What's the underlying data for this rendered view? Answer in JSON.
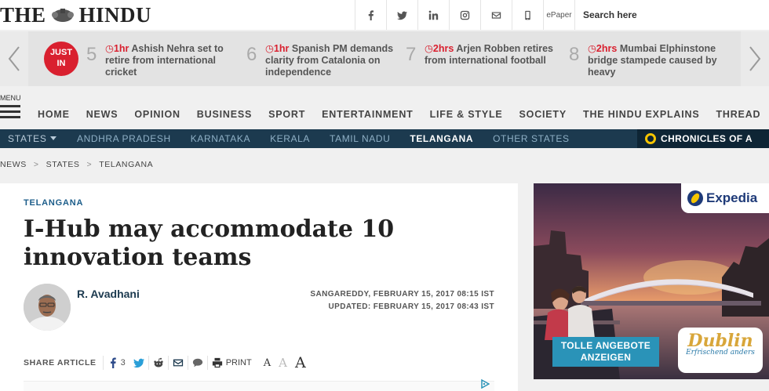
{
  "header": {
    "logo": "THE HINDU",
    "logo_left": "THE",
    "logo_right": "HINDU",
    "social_icons": [
      "facebook-icon",
      "twitter-icon",
      "linkedin-icon",
      "instagram-icon",
      "email-icon",
      "mobile-icon"
    ],
    "epaper_label": "ePaper",
    "search_label": "Search here"
  },
  "ticker": {
    "badge_line1": "JUST",
    "badge_line2": "IN",
    "items": [
      {
        "num": "5",
        "time": "1hr",
        "text": "Ashish Nehra set to retire from international cricket"
      },
      {
        "num": "6",
        "time": "1hr",
        "text": "Spanish PM demands clarity from Catalonia on independence"
      },
      {
        "num": "7",
        "time": "2hrs",
        "text": "Arjen Robben retires from international football"
      },
      {
        "num": "8",
        "time": "2hrs",
        "text": "Mumbai Elphinstone bridge stampede caused by heavy"
      }
    ]
  },
  "nav": {
    "menu_label": "MENU",
    "items": [
      "HOME",
      "NEWS",
      "OPINION",
      "BUSINESS",
      "SPORT",
      "ENTERTAINMENT",
      "LIFE & STYLE",
      "SOCIETY",
      "THE HINDU EXPLAINS",
      "THREAD"
    ]
  },
  "subnav": {
    "states_label": "STATES",
    "items": [
      "ANDHRA PRADESH",
      "KARNATAKA",
      "KERALA",
      "TAMIL NADU",
      "TELANGANA",
      "OTHER STATES"
    ],
    "active": "TELANGANA",
    "chronicles_label": "CHRONICLES OF A"
  },
  "breadcrumb": [
    "NEWS",
    "STATES",
    "TELANGANA"
  ],
  "article": {
    "section": "TELANGANA",
    "headline": "I-Hub may accommodate 10 innovation teams",
    "author": "R. Avadhani",
    "dateline": "SANGAREDDY, FEBRUARY 15, 2017 08:15 IST",
    "updated": "UPDATED: FEBRUARY 15, 2017 08:43 IST",
    "share_label": "SHARE ARTICLE",
    "fb_count": "3",
    "print_label": "PRINT",
    "font_sizes": [
      "A",
      "A",
      "A"
    ]
  },
  "ad": {
    "brand": "Expedia",
    "cta_line1": "TOLLE ANGEBOTE",
    "cta_line2": "ANZEIGEN",
    "logo_title": "Dublin",
    "logo_sub": "Erfrischend anders"
  },
  "colors": {
    "brand_red": "#d9202f",
    "subnav_bg": "#1c3a4f",
    "section_blue": "#1c5d8a"
  }
}
